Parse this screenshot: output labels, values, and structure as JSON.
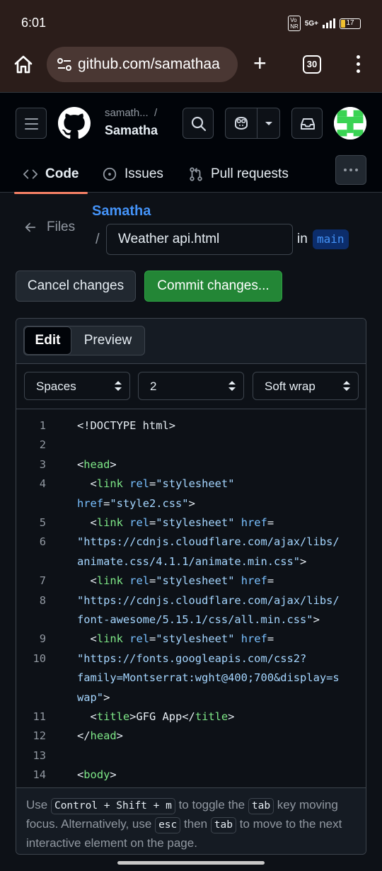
{
  "status_bar": {
    "time": "6:01",
    "network": "5G+",
    "volte": "Vo LTE",
    "battery": "17"
  },
  "browser": {
    "url": "github.com/samathaa",
    "tab_count": "30",
    "home_icon": "home-icon",
    "new_tab_icon": "plus-icon",
    "menu_icon": "kebab-menu-icon"
  },
  "header": {
    "owner": "samath...",
    "separator": "/",
    "repo": "Samatha"
  },
  "nav_tabs": [
    {
      "label": "Code",
      "icon": "code-icon",
      "active": true
    },
    {
      "label": "Issues",
      "icon": "issue-icon",
      "active": false
    },
    {
      "label": "Pull requests",
      "icon": "pull-request-icon",
      "active": false
    }
  ],
  "path": {
    "files_label": "Files",
    "repo_link": "Samatha",
    "separator": "/",
    "filename": "Weather api.html",
    "in_label": "in",
    "branch": "main"
  },
  "actions": {
    "cancel": "Cancel changes",
    "commit": "Commit changes..."
  },
  "editor": {
    "tabs": {
      "edit": "Edit",
      "preview": "Preview"
    },
    "indent_mode": "Spaces",
    "indent_size": "2",
    "wrap_mode": "Soft wrap"
  },
  "code_lines": [
    {
      "n": "1",
      "segs": [
        [
          "p",
          "<!DOCTYPE html>"
        ]
      ]
    },
    {
      "n": "2",
      "segs": []
    },
    {
      "n": "3",
      "segs": [
        [
          "p",
          "<"
        ],
        [
          "t",
          "head"
        ],
        [
          "p",
          ">"
        ]
      ]
    },
    {
      "n": "4",
      "segs": [
        [
          "p",
          "  <"
        ],
        [
          "t",
          "link"
        ],
        [
          "p",
          " "
        ],
        [
          "a",
          "rel"
        ],
        [
          "p",
          "="
        ],
        [
          "s",
          "\"stylesheet\""
        ]
      ]
    },
    {
      "n": "",
      "segs": [
        [
          "a",
          "href"
        ],
        [
          "p",
          "="
        ],
        [
          "s",
          "\"style2.css\""
        ],
        [
          "p",
          ">"
        ]
      ]
    },
    {
      "n": "5",
      "segs": [
        [
          "p",
          "  <"
        ],
        [
          "t",
          "link"
        ],
        [
          "p",
          " "
        ],
        [
          "a",
          "rel"
        ],
        [
          "p",
          "="
        ],
        [
          "s",
          "\"stylesheet\""
        ],
        [
          "p",
          " "
        ],
        [
          "a",
          "href"
        ],
        [
          "p",
          "="
        ]
      ]
    },
    {
      "n": "6",
      "segs": [
        [
          "s",
          "\"https://cdnjs.cloudflare.com/ajax/libs/"
        ]
      ]
    },
    {
      "n": "",
      "segs": [
        [
          "s",
          "animate.css/4.1.1/animate.min.css\""
        ],
        [
          "p",
          ">"
        ]
      ]
    },
    {
      "n": "7",
      "segs": [
        [
          "p",
          "  <"
        ],
        [
          "t",
          "link"
        ],
        [
          "p",
          " "
        ],
        [
          "a",
          "rel"
        ],
        [
          "p",
          "="
        ],
        [
          "s",
          "\"stylesheet\""
        ],
        [
          "p",
          " "
        ],
        [
          "a",
          "href"
        ],
        [
          "p",
          "="
        ]
      ]
    },
    {
      "n": "8",
      "segs": [
        [
          "s",
          "\"https://cdnjs.cloudflare.com/ajax/libs/"
        ]
      ]
    },
    {
      "n": "",
      "segs": [
        [
          "s",
          "font-awesome/5.15.1/css/all.min.css\""
        ],
        [
          "p",
          ">"
        ]
      ]
    },
    {
      "n": "9",
      "segs": [
        [
          "p",
          "  <"
        ],
        [
          "t",
          "link"
        ],
        [
          "p",
          " "
        ],
        [
          "a",
          "rel"
        ],
        [
          "p",
          "="
        ],
        [
          "s",
          "\"stylesheet\""
        ],
        [
          "p",
          " "
        ],
        [
          "a",
          "href"
        ],
        [
          "p",
          "="
        ]
      ]
    },
    {
      "n": "10",
      "segs": [
        [
          "s",
          "\"https://fonts.googleapis.com/css2?"
        ]
      ]
    },
    {
      "n": "",
      "segs": [
        [
          "s",
          "family=Montserrat:wght@400;700&display=s"
        ]
      ]
    },
    {
      "n": "",
      "segs": [
        [
          "s",
          "wap\""
        ],
        [
          "p",
          ">"
        ]
      ]
    },
    {
      "n": "11",
      "segs": [
        [
          "p",
          "  <"
        ],
        [
          "t",
          "title"
        ],
        [
          "p",
          ">GFG App</"
        ],
        [
          "t",
          "title"
        ],
        [
          "p",
          ">"
        ]
      ]
    },
    {
      "n": "12",
      "segs": [
        [
          "p",
          "</"
        ],
        [
          "t",
          "head"
        ],
        [
          "p",
          ">"
        ]
      ]
    },
    {
      "n": "13",
      "segs": []
    },
    {
      "n": "14",
      "segs": [
        [
          "p",
          "<"
        ],
        [
          "t",
          "body"
        ],
        [
          "p",
          ">"
        ]
      ]
    }
  ],
  "footer": {
    "t1": "Use ",
    "k1": "Control + Shift + m",
    "t2": " to toggle the ",
    "k2": "tab",
    "t3": " key moving focus. Alternatively, use ",
    "k3": "esc",
    "t4": " then ",
    "k4": "tab",
    "t5": " to move to the next interactive element on the page."
  },
  "colors": {
    "accent_blue": "#4493f8",
    "commit_green": "#238636",
    "tab_underline": "#f78166",
    "browser_chrome": "#2b1d1a"
  }
}
